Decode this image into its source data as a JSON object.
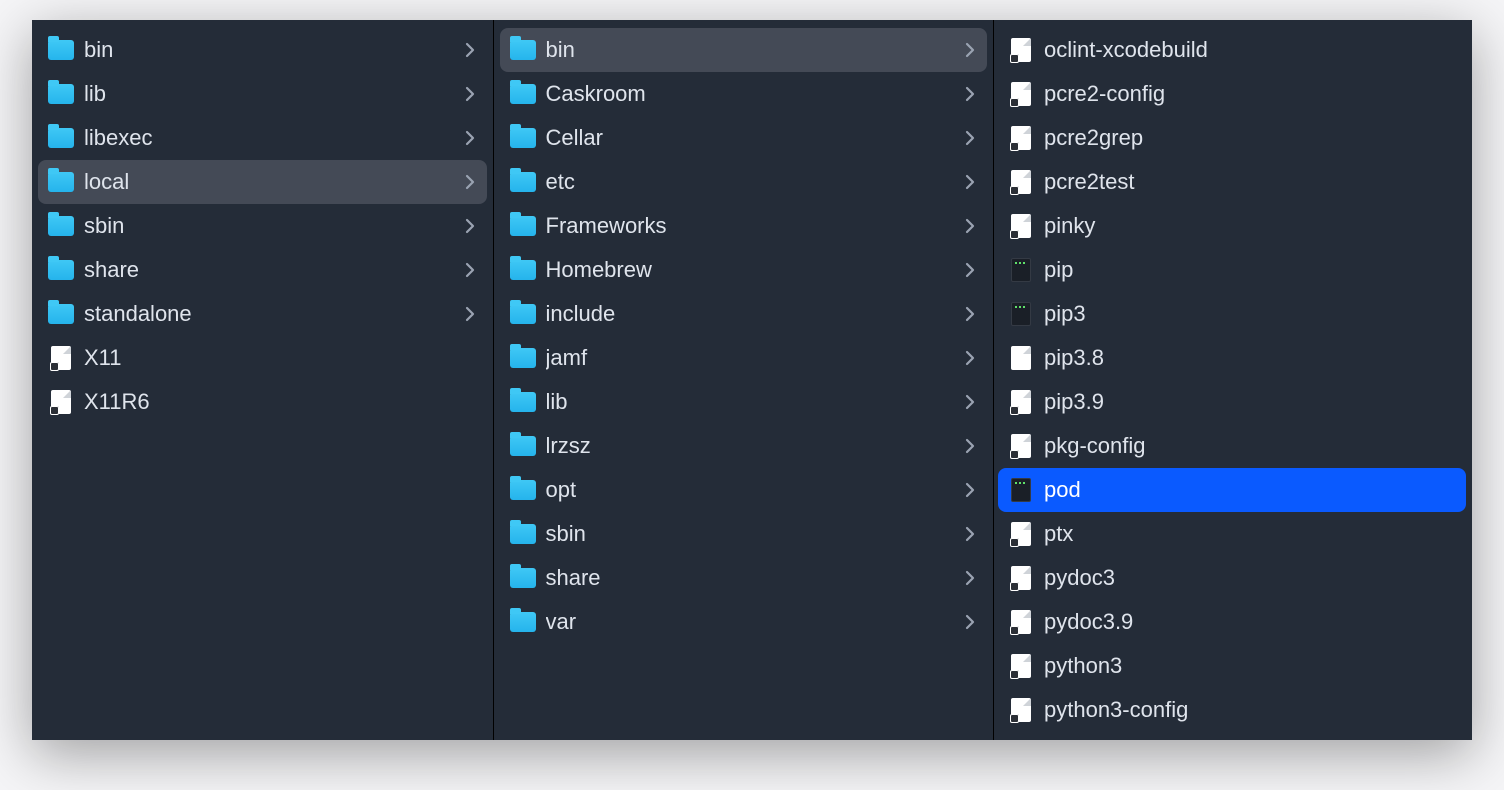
{
  "columns": [
    {
      "items": [
        {
          "name": "bin",
          "type": "folder",
          "hasChildren": true,
          "active": false,
          "selected": false
        },
        {
          "name": "lib",
          "type": "folder",
          "hasChildren": true,
          "active": false,
          "selected": false
        },
        {
          "name": "libexec",
          "type": "folder",
          "hasChildren": true,
          "active": false,
          "selected": false
        },
        {
          "name": "local",
          "type": "folder",
          "hasChildren": true,
          "active": true,
          "selected": false
        },
        {
          "name": "sbin",
          "type": "folder",
          "hasChildren": true,
          "active": false,
          "selected": false
        },
        {
          "name": "share",
          "type": "folder",
          "hasChildren": true,
          "active": false,
          "selected": false
        },
        {
          "name": "standalone",
          "type": "folder",
          "hasChildren": true,
          "active": false,
          "selected": false
        },
        {
          "name": "X11",
          "type": "alias",
          "hasChildren": false,
          "active": false,
          "selected": false
        },
        {
          "name": "X11R6",
          "type": "alias",
          "hasChildren": false,
          "active": false,
          "selected": false
        }
      ]
    },
    {
      "items": [
        {
          "name": "bin",
          "type": "folder",
          "hasChildren": true,
          "active": true,
          "selected": false
        },
        {
          "name": "Caskroom",
          "type": "folder",
          "hasChildren": true,
          "active": false,
          "selected": false
        },
        {
          "name": "Cellar",
          "type": "folder",
          "hasChildren": true,
          "active": false,
          "selected": false
        },
        {
          "name": "etc",
          "type": "folder",
          "hasChildren": true,
          "active": false,
          "selected": false
        },
        {
          "name": "Frameworks",
          "type": "folder",
          "hasChildren": true,
          "active": false,
          "selected": false
        },
        {
          "name": "Homebrew",
          "type": "folder",
          "hasChildren": true,
          "active": false,
          "selected": false
        },
        {
          "name": "include",
          "type": "folder",
          "hasChildren": true,
          "active": false,
          "selected": false
        },
        {
          "name": "jamf",
          "type": "folder",
          "hasChildren": true,
          "active": false,
          "selected": false
        },
        {
          "name": "lib",
          "type": "folder",
          "hasChildren": true,
          "active": false,
          "selected": false
        },
        {
          "name": "lrzsz",
          "type": "folder",
          "hasChildren": true,
          "active": false,
          "selected": false
        },
        {
          "name": "opt",
          "type": "folder",
          "hasChildren": true,
          "active": false,
          "selected": false
        },
        {
          "name": "sbin",
          "type": "folder",
          "hasChildren": true,
          "active": false,
          "selected": false
        },
        {
          "name": "share",
          "type": "folder",
          "hasChildren": true,
          "active": false,
          "selected": false
        },
        {
          "name": "var",
          "type": "folder",
          "hasChildren": true,
          "active": false,
          "selected": false
        }
      ]
    },
    {
      "items": [
        {
          "name": "oclint-xcodebuild",
          "type": "alias",
          "hasChildren": false,
          "active": false,
          "selected": false
        },
        {
          "name": "pcre2-config",
          "type": "alias",
          "hasChildren": false,
          "active": false,
          "selected": false
        },
        {
          "name": "pcre2grep",
          "type": "alias",
          "hasChildren": false,
          "active": false,
          "selected": false
        },
        {
          "name": "pcre2test",
          "type": "alias",
          "hasChildren": false,
          "active": false,
          "selected": false
        },
        {
          "name": "pinky",
          "type": "alias",
          "hasChildren": false,
          "active": false,
          "selected": false
        },
        {
          "name": "pip",
          "type": "exec",
          "hasChildren": false,
          "active": false,
          "selected": false
        },
        {
          "name": "pip3",
          "type": "exec",
          "hasChildren": false,
          "active": false,
          "selected": false
        },
        {
          "name": "pip3.8",
          "type": "doc",
          "hasChildren": false,
          "active": false,
          "selected": false
        },
        {
          "name": "pip3.9",
          "type": "alias",
          "hasChildren": false,
          "active": false,
          "selected": false
        },
        {
          "name": "pkg-config",
          "type": "alias",
          "hasChildren": false,
          "active": false,
          "selected": false
        },
        {
          "name": "pod",
          "type": "exec",
          "hasChildren": false,
          "active": false,
          "selected": true
        },
        {
          "name": "ptx",
          "type": "alias",
          "hasChildren": false,
          "active": false,
          "selected": false
        },
        {
          "name": "pydoc3",
          "type": "alias",
          "hasChildren": false,
          "active": false,
          "selected": false
        },
        {
          "name": "pydoc3.9",
          "type": "alias",
          "hasChildren": false,
          "active": false,
          "selected": false
        },
        {
          "name": "python3",
          "type": "alias",
          "hasChildren": false,
          "active": false,
          "selected": false
        },
        {
          "name": "python3-config",
          "type": "alias",
          "hasChildren": false,
          "active": false,
          "selected": false
        }
      ]
    }
  ]
}
